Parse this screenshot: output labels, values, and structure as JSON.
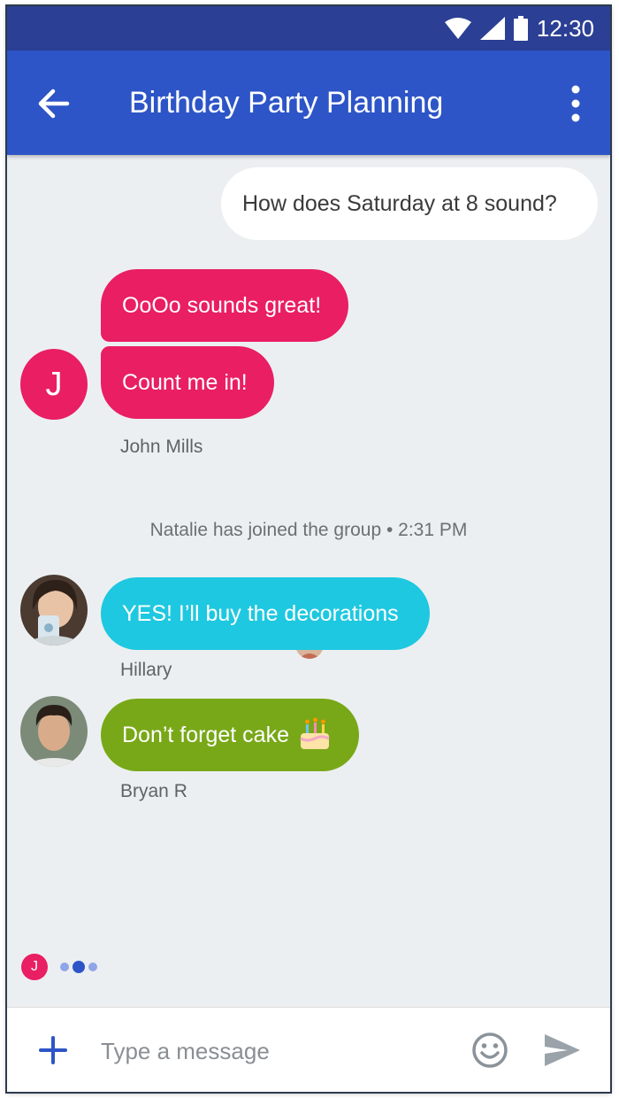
{
  "status_bar": {
    "time": "12:30",
    "icons": [
      "wifi-icon",
      "signal-icon",
      "battery-icon"
    ]
  },
  "app_bar": {
    "title": "Birthday Party Planning",
    "icons": [
      "back-arrow-icon",
      "more-vert-icon"
    ]
  },
  "messages": [
    {
      "sender": "",
      "text": "How does Saturday at 8 sound?",
      "direction": "outgoing",
      "color": "#ffffff"
    },
    {
      "sender": "John Mills",
      "text": "OoOo sounds great!",
      "direction": "incoming",
      "color": "#e91e63"
    },
    {
      "sender": "John Mills",
      "text": "Count me in!",
      "direction": "incoming",
      "color": "#e91e63"
    },
    {
      "sender": "Hillary",
      "text": "YES! I’ll buy the decorations",
      "direction": "incoming",
      "color": "#1ec8e0"
    },
    {
      "sender": "Bryan R",
      "text": "Don’t forget cake",
      "direction": "incoming",
      "color": "#78a818",
      "emoji": "birthday-cake-icon"
    }
  ],
  "system_message": "Natalie has joined the group • 2:31 PM",
  "avatars": {
    "john_initial": "J"
  },
  "typing_indicator": {
    "initial": "J"
  },
  "compose": {
    "placeholder": "Type a message",
    "icons": [
      "add-icon",
      "emoji-icon",
      "send-icon"
    ]
  },
  "colors": {
    "status_bar": "#2b3f94",
    "app_bar": "#2d55c7",
    "background": "#eceff1",
    "accent": "#2d55c7"
  }
}
